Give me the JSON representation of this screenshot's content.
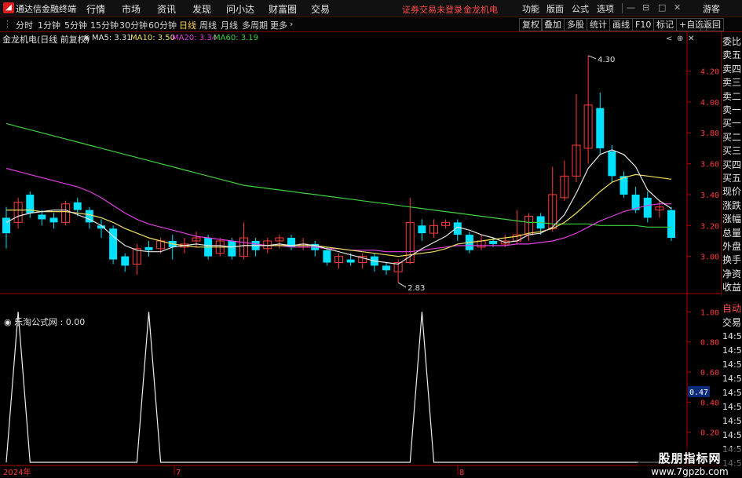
{
  "app_title": "通达信金融终端",
  "menu": [
    "行情",
    "市场",
    "资讯",
    "发现",
    "问小达",
    "财富圈",
    "交易"
  ],
  "status_warning": "证券交易未登录",
  "status_stock": "金龙机电",
  "right_menu": [
    "功能",
    "版面",
    "公式",
    "选项"
  ],
  "guest": "游客",
  "periods": [
    "分时",
    "1分钟",
    "5分钟",
    "15分钟",
    "30分钟",
    "60分钟",
    "日线",
    "周线",
    "月线",
    "多周期",
    "更多"
  ],
  "active_period": "日线",
  "tool_buttons": [
    "复权",
    "叠加",
    "多股",
    "统计",
    "画线",
    "F10",
    "标记",
    "+自选",
    "返回"
  ],
  "stock": {
    "name": "金龙机电",
    "mode": "(日线 前复权)"
  },
  "ma_labels": [
    {
      "text": "MA5: 3.31",
      "color": "#e6e6e6"
    },
    {
      "text": "MA10: 3.50",
      "color": "#f0e060"
    },
    {
      "text": "MA20: 3.34",
      "color": "#e040e0"
    },
    {
      "text": "MA60: 3.19",
      "color": "#40d040"
    }
  ],
  "quote_labels": [
    "委比",
    "卖五",
    "卖四",
    "卖三",
    "卖二",
    "卖一",
    "买一",
    "买二",
    "买三",
    "买四",
    "买五",
    "现价",
    "涨跌",
    "涨幅",
    "总量",
    "外盘",
    "换手",
    "净资",
    "收益"
  ],
  "sub_quote_labels": [
    "自动",
    "交易"
  ],
  "time_labels": [
    "14:56",
    "14:56",
    "14:56",
    "14:56",
    "14:56",
    "14:56",
    "14:56",
    "14:56",
    "14:56",
    "14:56"
  ],
  "sub_chart_title": "乐淘公式网 : 0.00",
  "watermark": {
    "line1": "股朋指标网",
    "line2": "www.7gpzb.com"
  },
  "colors": {
    "up": "#ff3b3b",
    "down": "#00e0ff",
    "ma5": "#e6e6e6",
    "ma10": "#f0e060",
    "ma20": "#e040e0",
    "ma60": "#40d040",
    "frame": "#b00000"
  },
  "chart_data": {
    "type": "candlestick",
    "y_axis_ticks": [
      "4.20",
      "4.00",
      "3.80",
      "3.60",
      "3.40",
      "3.20",
      "3.00"
    ],
    "ylim": [
      2.8,
      4.35
    ],
    "high_label": "4.30",
    "low_label": "2.83",
    "x_labels": [
      "2024年",
      "7",
      "8"
    ],
    "candles": [
      [
        3.25,
        3.15,
        3.32,
        3.05
      ],
      [
        3.22,
        3.35,
        3.38,
        3.18
      ],
      [
        3.4,
        3.28,
        3.42,
        3.25
      ],
      [
        3.27,
        3.24,
        3.3,
        3.2
      ],
      [
        3.25,
        3.22,
        3.28,
        3.18
      ],
      [
        3.22,
        3.34,
        3.36,
        3.2
      ],
      [
        3.35,
        3.3,
        3.38,
        3.26
      ],
      [
        3.3,
        3.22,
        3.32,
        3.18
      ],
      [
        3.2,
        3.18,
        3.24,
        3.12
      ],
      [
        3.18,
        2.98,
        3.2,
        2.95
      ],
      [
        3.0,
        2.94,
        3.02,
        2.9
      ],
      [
        2.95,
        3.05,
        3.08,
        2.88
      ],
      [
        3.06,
        3.04,
        3.1,
        3.0
      ],
      [
        3.05,
        3.1,
        3.12,
        3.02
      ],
      [
        3.1,
        3.06,
        3.14,
        2.98
      ],
      [
        3.06,
        3.08,
        3.12,
        3.02
      ],
      [
        3.1,
        3.12,
        3.16,
        3.06
      ],
      [
        3.12,
        3.0,
        3.14,
        2.98
      ],
      [
        3.02,
        3.1,
        3.12,
        3.0
      ],
      [
        3.1,
        3.0,
        3.12,
        2.98
      ],
      [
        3.0,
        3.12,
        3.22,
        2.98
      ],
      [
        3.1,
        3.04,
        3.12,
        3.0
      ],
      [
        3.05,
        3.1,
        3.12,
        3.02
      ],
      [
        3.1,
        3.12,
        3.14,
        3.05
      ],
      [
        3.12,
        3.06,
        3.14,
        3.04
      ],
      [
        3.06,
        3.08,
        3.12,
        3.04
      ],
      [
        3.08,
        3.04,
        3.1,
        3.0
      ],
      [
        3.04,
        2.96,
        3.06,
        2.94
      ],
      [
        2.96,
        3.0,
        3.02,
        2.92
      ],
      [
        2.98,
        2.96,
        3.02,
        2.94
      ],
      [
        2.96,
        3.0,
        3.02,
        2.92
      ],
      [
        3.0,
        2.94,
        3.02,
        2.9
      ],
      [
        2.94,
        2.91,
        2.96,
        2.88
      ],
      [
        2.9,
        2.96,
        2.98,
        2.83
      ],
      [
        2.96,
        3.22,
        3.38,
        2.95
      ],
      [
        3.2,
        3.15,
        3.24,
        3.1
      ],
      [
        3.15,
        3.2,
        3.24,
        3.12
      ],
      [
        3.2,
        3.22,
        3.24,
        3.18
      ],
      [
        3.22,
        3.14,
        3.24,
        3.1
      ],
      [
        3.14,
        3.04,
        3.16,
        3.02
      ],
      [
        3.06,
        3.1,
        3.14,
        3.04
      ],
      [
        3.1,
        3.08,
        3.12,
        3.06
      ],
      [
        3.08,
        3.1,
        3.14,
        3.06
      ],
      [
        3.1,
        3.14,
        3.3,
        3.08
      ],
      [
        3.14,
        3.26,
        3.28,
        3.1
      ],
      [
        3.26,
        3.18,
        3.28,
        3.14
      ],
      [
        3.18,
        3.4,
        3.58,
        3.16
      ],
      [
        3.38,
        3.52,
        3.62,
        3.36
      ],
      [
        3.52,
        3.72,
        4.05,
        3.48
      ],
      [
        3.7,
        3.98,
        4.3,
        3.6
      ],
      [
        3.96,
        3.7,
        4.06,
        3.66
      ],
      [
        3.68,
        3.52,
        3.72,
        3.48
      ],
      [
        3.52,
        3.4,
        3.55,
        3.38
      ],
      [
        3.4,
        3.3,
        3.45,
        3.28
      ],
      [
        3.38,
        3.25,
        3.42,
        3.22
      ],
      [
        3.3,
        3.32,
        3.36,
        3.25
      ],
      [
        3.3,
        3.12,
        3.32,
        3.1
      ]
    ],
    "ma5": [
      3.22,
      3.26,
      3.28,
      3.29,
      3.3,
      3.3,
      3.27,
      3.24,
      3.2,
      3.13,
      3.07,
      3.04,
      3.03,
      3.03,
      3.06,
      3.07,
      3.08,
      3.07,
      3.07,
      3.06,
      3.07,
      3.07,
      3.07,
      3.08,
      3.07,
      3.08,
      3.07,
      3.05,
      3.03,
      3.01,
      2.99,
      2.97,
      2.96,
      2.95,
      3.0,
      3.05,
      3.09,
      3.13,
      3.19,
      3.17,
      3.14,
      3.12,
      3.09,
      3.1,
      3.14,
      3.15,
      3.19,
      3.27,
      3.41,
      3.57,
      3.66,
      3.69,
      3.66,
      3.58,
      3.43,
      3.36,
      3.31
    ],
    "ma10": [
      3.3,
      3.3,
      3.3,
      3.29,
      3.29,
      3.29,
      3.28,
      3.27,
      3.25,
      3.22,
      3.18,
      3.15,
      3.12,
      3.1,
      3.08,
      3.07,
      3.06,
      3.06,
      3.06,
      3.06,
      3.07,
      3.07,
      3.07,
      3.07,
      3.07,
      3.07,
      3.07,
      3.06,
      3.05,
      3.04,
      3.03,
      3.02,
      3.01,
      3.0,
      3.01,
      3.02,
      3.03,
      3.05,
      3.08,
      3.09,
      3.1,
      3.11,
      3.12,
      3.13,
      3.15,
      3.16,
      3.18,
      3.22,
      3.28,
      3.35,
      3.42,
      3.48,
      3.51,
      3.53,
      3.52,
      3.51,
      3.5
    ],
    "ma20": [
      3.57,
      3.55,
      3.53,
      3.51,
      3.49,
      3.47,
      3.45,
      3.42,
      3.38,
      3.33,
      3.28,
      3.24,
      3.21,
      3.19,
      3.17,
      3.15,
      3.13,
      3.12,
      3.11,
      3.1,
      3.09,
      3.08,
      3.07,
      3.07,
      3.06,
      3.06,
      3.06,
      3.05,
      3.05,
      3.04,
      3.04,
      3.04,
      3.03,
      3.03,
      3.03,
      3.04,
      3.05,
      3.06,
      3.07,
      3.07,
      3.07,
      3.07,
      3.07,
      3.08,
      3.08,
      3.09,
      3.1,
      3.12,
      3.15,
      3.19,
      3.23,
      3.26,
      3.29,
      3.31,
      3.33,
      3.34,
      3.34
    ],
    "ma60": [
      3.86,
      3.84,
      3.82,
      3.8,
      3.78,
      3.76,
      3.74,
      3.72,
      3.7,
      3.68,
      3.66,
      3.64,
      3.62,
      3.6,
      3.58,
      3.56,
      3.54,
      3.52,
      3.5,
      3.48,
      3.46,
      3.45,
      3.44,
      3.43,
      3.42,
      3.41,
      3.4,
      3.39,
      3.38,
      3.37,
      3.36,
      3.35,
      3.34,
      3.33,
      3.32,
      3.31,
      3.3,
      3.29,
      3.28,
      3.27,
      3.26,
      3.25,
      3.24,
      3.23,
      3.22,
      3.22,
      3.21,
      3.21,
      3.21,
      3.21,
      3.2,
      3.2,
      3.2,
      3.2,
      3.19,
      3.19,
      3.19
    ],
    "sub_chart": {
      "type": "line",
      "y_axis_ticks": [
        "1.00",
        "0.80",
        "0.60",
        "0.40",
        "0.20"
      ],
      "ylim": [
        0,
        1.08
      ],
      "current_value": "0.47",
      "spike_indices": [
        1,
        12,
        35
      ]
    }
  }
}
